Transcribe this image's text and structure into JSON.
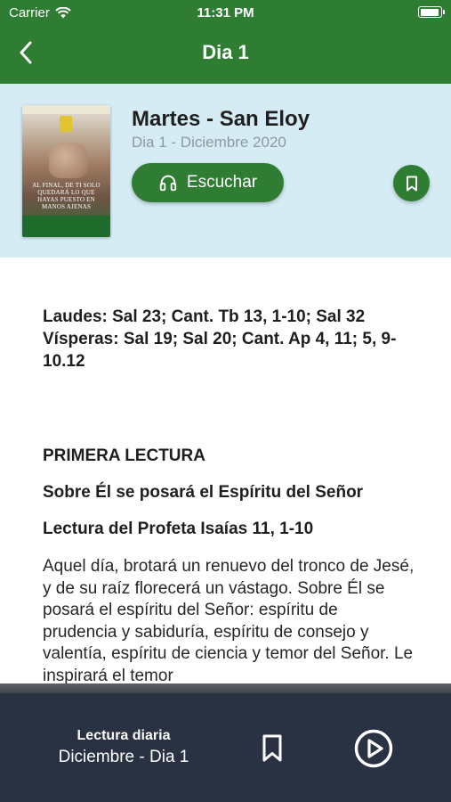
{
  "status_bar": {
    "carrier": "Carrier",
    "time": "11:31 PM"
  },
  "nav": {
    "title": "Dia 1",
    "back_icon": "chevron-left-icon"
  },
  "header": {
    "title": "Martes - San Eloy",
    "subtitle": "Dia 1 - Diciembre 2020",
    "listen_label": "Escuchar",
    "listen_icon": "headphones-icon",
    "bookmark_icon": "bookmark-icon",
    "cover_text": "AL FINAL, DE TI SOLO QUEDARÁ LO QUE HAYAS PUESTO EN MANOS AJENAS"
  },
  "content": {
    "psalms_line1": "Laudes: Sal 23; Cant. Tb 13, 1-10; Sal 32",
    "psalms_line2": "Vísperas: Sal 19; Sal 20; Cant. Ap 4, 11; 5, 9-10.12",
    "section_title": "PRIMERA LECTURA",
    "subtitle1": "Sobre Él se posará el Espíritu del Señor",
    "subtitle2": "Lectura del Profeta Isaías 11, 1-10",
    "body": "Aquel día, brotará un renuevo del tronco de Jesé, y de su raíz florecerá un vástago. Sobre Él se posará el espíritu del Señor: espíritu de prudencia y sabiduría, espíritu de consejo y valentía, espíritu de ciencia y temor del Señor. Le inspirará el temor"
  },
  "player": {
    "title": "Lectura diaria",
    "subtitle": "Diciembre - Dia 1",
    "bookmark_icon": "bookmark-icon",
    "play_icon": "play-circle-icon"
  },
  "colors": {
    "brand_green": "#2e7d32",
    "header_bg": "#d5ecf4",
    "player_bg": "#283243"
  }
}
